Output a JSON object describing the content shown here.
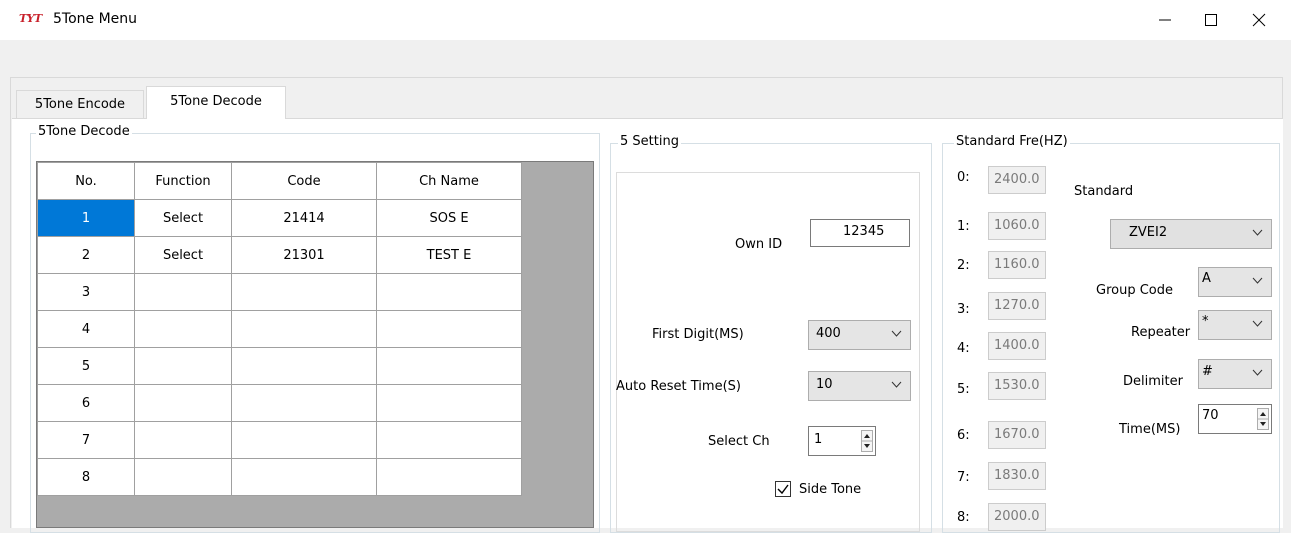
{
  "window": {
    "logo_text": "TYT",
    "title": "5Tone Menu",
    "minimize": "—",
    "maximize": "☐",
    "close": "✕"
  },
  "tabs": [
    {
      "label": "5Tone Encode",
      "active": false
    },
    {
      "label": "5Tone Decode",
      "active": true
    }
  ],
  "decode": {
    "group_label": "5Tone Decode",
    "columns": [
      "No.",
      "Function",
      "Code",
      "Ch Name"
    ],
    "rows": [
      {
        "no": "1",
        "function": "Select",
        "code": "21414",
        "ch_name": "SOS E"
      },
      {
        "no": "2",
        "function": "Select",
        "code": "21301",
        "ch_name": "TEST E"
      },
      {
        "no": "3",
        "function": "",
        "code": "",
        "ch_name": ""
      },
      {
        "no": "4",
        "function": "",
        "code": "",
        "ch_name": ""
      },
      {
        "no": "5",
        "function": "",
        "code": "",
        "ch_name": ""
      },
      {
        "no": "6",
        "function": "",
        "code": "",
        "ch_name": ""
      },
      {
        "no": "7",
        "function": "",
        "code": "",
        "ch_name": ""
      },
      {
        "no": "8",
        "function": "",
        "code": "",
        "ch_name": ""
      }
    ],
    "selected_row": 0,
    "selection_color": "#0078d7"
  },
  "setting": {
    "group_label": "5 Setting",
    "own_id_label": "Own ID",
    "own_id_value": "12345",
    "first_digit_label": "First Digit(MS)",
    "first_digit_value": "400",
    "auto_reset_label": "Auto Reset Time(S)",
    "auto_reset_value": "10",
    "select_ch_label": "Select Ch",
    "select_ch_value": "1",
    "side_tone_label": "Side Tone",
    "side_tone_checked": true
  },
  "standard": {
    "group_label": "Standard Fre(HZ)",
    "freqs": [
      {
        "idx": "0:",
        "value": "2400.0"
      },
      {
        "idx": "1:",
        "value": "1060.0"
      },
      {
        "idx": "2:",
        "value": "1160.0"
      },
      {
        "idx": "3:",
        "value": "1270.0"
      },
      {
        "idx": "4:",
        "value": "1400.0"
      },
      {
        "idx": "5:",
        "value": "1530.0"
      },
      {
        "idx": "6:",
        "value": "1670.0"
      },
      {
        "idx": "7:",
        "value": "1830.0"
      },
      {
        "idx": "8:",
        "value": "2000.0"
      }
    ],
    "standard_label": "Standard",
    "standard_value": "ZVEI2",
    "group_code_label": "Group Code",
    "group_code_value": "A",
    "repeater_label": "Repeater",
    "repeater_value": "*",
    "delimiter_label": "Delimiter",
    "delimiter_value": "#",
    "time_label": "Time(MS)",
    "time_value": "70"
  }
}
